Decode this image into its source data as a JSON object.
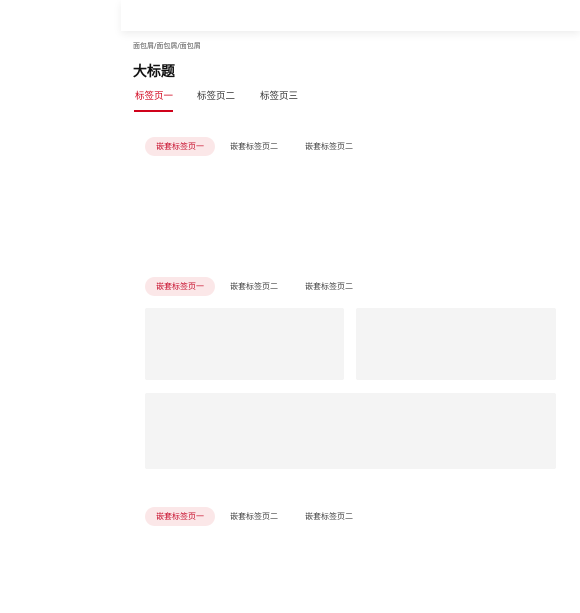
{
  "breadcrumb": {
    "items": [
      "面包屑",
      "面包屑",
      "面包屑"
    ],
    "separator": "/"
  },
  "page": {
    "title": "大标题"
  },
  "tabs": [
    {
      "label": "标签页一",
      "active": true
    },
    {
      "label": "标签页二",
      "active": false
    },
    {
      "label": "标签页三",
      "active": false
    }
  ],
  "nested_groups": [
    {
      "tabs": [
        {
          "label": "嵌套标签页一",
          "active": true
        },
        {
          "label": "嵌套标签页二"
        },
        {
          "label": "嵌套标签页二"
        }
      ]
    },
    {
      "tabs": [
        {
          "label": "嵌套标签页一",
          "active": true
        },
        {
          "label": "嵌套标签页二"
        },
        {
          "label": "嵌套标签页二"
        }
      ]
    },
    {
      "tabs": [
        {
          "label": "嵌套标签页一",
          "active": true
        },
        {
          "label": "嵌套标签页二"
        },
        {
          "label": "嵌套标签页二"
        }
      ]
    }
  ],
  "colors": {
    "accent": "#d0021b",
    "pill_bg": "#fbe7e8",
    "card_bg": "#f4f4f4"
  }
}
